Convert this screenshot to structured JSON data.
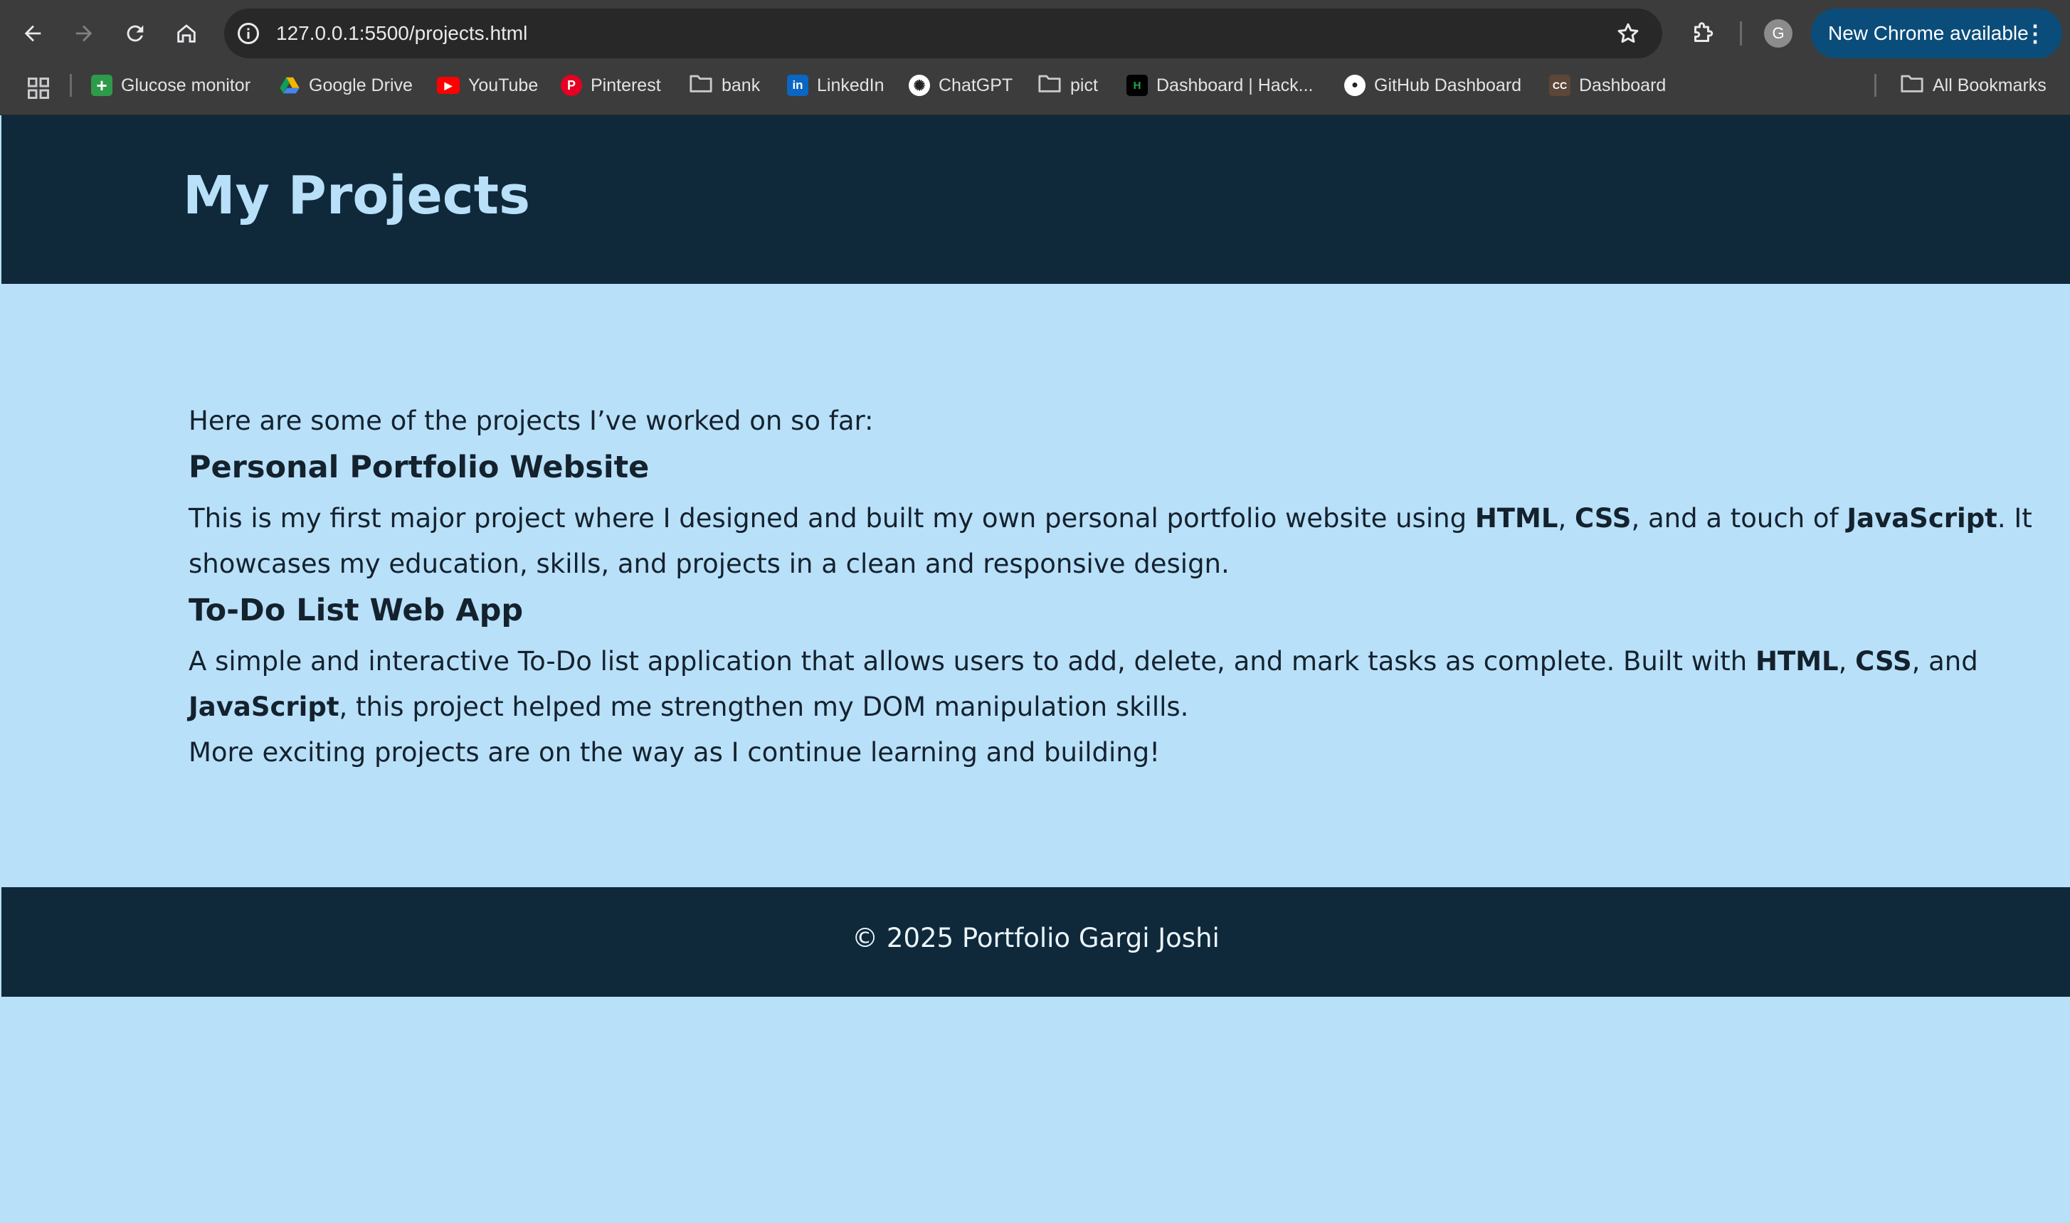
{
  "browser": {
    "url": "127.0.0.1:5500/projects.html",
    "profile_initial": "G",
    "update_label": "New Chrome available",
    "bookmarks": [
      {
        "label": "Glucose monitor",
        "icon": "plus-favicon-icon",
        "color": "#2e9b4a"
      },
      {
        "label": "Google Drive",
        "icon": "google-drive-icon",
        "color": "#f4b400"
      },
      {
        "label": "YouTube",
        "icon": "youtube-icon",
        "color": "#ff0000"
      },
      {
        "label": "Pinterest",
        "icon": "pinterest-icon",
        "color": "#e60023"
      },
      {
        "label": "bank",
        "icon": "folder-icon"
      },
      {
        "label": "LinkedIn",
        "icon": "linkedin-icon",
        "color": "#0a66c2"
      },
      {
        "label": "ChatGPT",
        "icon": "chatgpt-icon",
        "color": "#ffffff"
      },
      {
        "label": "pict",
        "icon": "folder-icon"
      },
      {
        "label": "Dashboard | Hack...",
        "icon": "hackerrank-icon",
        "color": "#000000"
      },
      {
        "label": "GitHub Dashboard",
        "icon": "github-icon",
        "color": "#ffffff"
      },
      {
        "label": "Dashboard",
        "icon": "codechef-icon",
        "color": "#5b4638"
      }
    ],
    "all_bookmarks_label": "All Bookmarks"
  },
  "page": {
    "title": "My Projects",
    "intro": "Here are some of the projects I’ve worked on so far:",
    "projects": [
      {
        "title": "Personal Portfolio Website",
        "line1": {
          "t1": "This is my first major project where I designed and built my own personal portfolio website using ",
          "b1": "HTML",
          "t2": ", ",
          "b2": "CSS",
          "t3": ", and a touch of ",
          "b3": "JavaScript",
          "t4": ". It"
        },
        "line2": "showcases my education, skills, and projects in a clean and responsive design."
      },
      {
        "title": "To-Do List Web App",
        "line1": {
          "t1": "A simple and interactive To-Do list application that allows users to add, delete, and mark tasks as complete. Built with ",
          "b1": "HTML",
          "t2": ", ",
          "b2": "CSS",
          "t3": ", and"
        },
        "line2": {
          "b1": "JavaScript",
          "t1": ", this project helped me strengthen my DOM manipulation skills."
        }
      }
    ],
    "closing": "More exciting projects are on the way as I continue learning and building!",
    "footer": "© 2025 Portfolio Gargi Joshi"
  },
  "colors": {
    "header_bg": "#10293a",
    "page_bg": "#b9e0f9",
    "title_color": "#b9e0f9"
  }
}
